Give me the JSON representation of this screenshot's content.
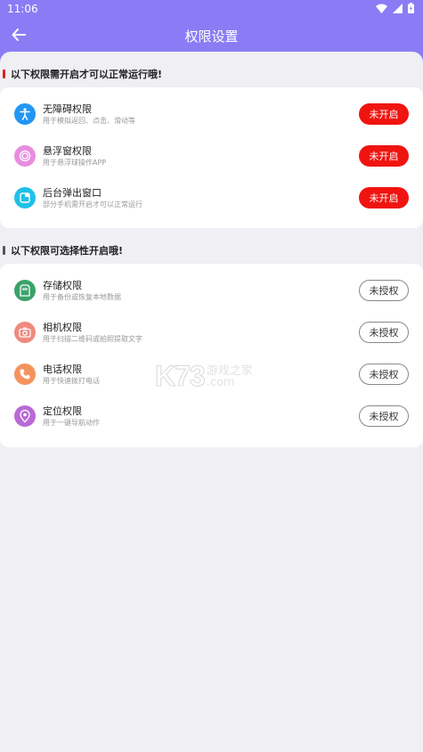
{
  "status_bar": {
    "time": "11:06"
  },
  "header": {
    "title": "权限设置"
  },
  "section_required": {
    "title": "以下权限需开启才可以正常运行哦!",
    "bar_color": "#e02020",
    "items": [
      {
        "name": "无障碍权限",
        "desc": "用于模拟返回、点击、滑动等",
        "button": "未开启",
        "icon": "accessibility-icon",
        "icon_color": "#2196f3"
      },
      {
        "name": "悬浮窗权限",
        "desc": "用于悬浮球操作APP",
        "button": "未开启",
        "icon": "floating-window-icon",
        "icon_color": "#e88de0"
      },
      {
        "name": "后台弹出窗口",
        "desc": "部分手机需开启才可以正常运行",
        "button": "未开启",
        "icon": "popup-window-icon",
        "icon_color": "#1fc0e8"
      }
    ]
  },
  "section_optional": {
    "title": "以下权限可选择性开启哦!",
    "bar_color": "#555555",
    "items": [
      {
        "name": "存储权限",
        "desc": "用于备份或恢复本地数据",
        "button": "未授权",
        "icon": "storage-icon",
        "icon_color": "#3aa368"
      },
      {
        "name": "相机权限",
        "desc": "用于扫描二维码或拍照提取文字",
        "button": "未授权",
        "icon": "camera-icon",
        "icon_color": "#ef8a7e"
      },
      {
        "name": "电话权限",
        "desc": "用于快速拨打电话",
        "button": "未授权",
        "icon": "phone-icon",
        "icon_color": "#f5935e"
      },
      {
        "name": "定位权限",
        "desc": "用于一键导航动作",
        "button": "未授权",
        "icon": "location-icon",
        "icon_color": "#b86ad6"
      }
    ]
  },
  "watermark": {
    "brand": "K73",
    "text": "游戏之家",
    "domain": ".com"
  }
}
